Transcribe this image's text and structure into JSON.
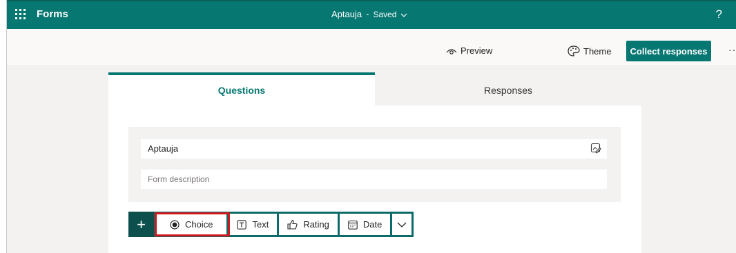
{
  "topbar": {
    "app_name": "Forms",
    "doc_title": "Aptauja",
    "separator": "-",
    "status": "Saved",
    "help": "?"
  },
  "cmdbar": {
    "preview_label": "Preview",
    "theme_label": "Theme",
    "collect_label": "Collect responses",
    "more_label": "···"
  },
  "tabs": [
    {
      "label": "Questions",
      "active": true
    },
    {
      "label": "Responses",
      "active": false
    }
  ],
  "form": {
    "title": "Aptauja",
    "description_placeholder": "Form description"
  },
  "add_question": {
    "plus": "+",
    "types": [
      {
        "label": "Choice",
        "icon": "radio-icon",
        "highlighted": true
      },
      {
        "label": "Text",
        "icon": "text-box-icon"
      },
      {
        "label": "Rating",
        "icon": "thumbs-up-icon"
      },
      {
        "label": "Date",
        "icon": "calendar-icon"
      }
    ]
  },
  "colors": {
    "brand": "#077772",
    "highlight": "#d0181f"
  }
}
